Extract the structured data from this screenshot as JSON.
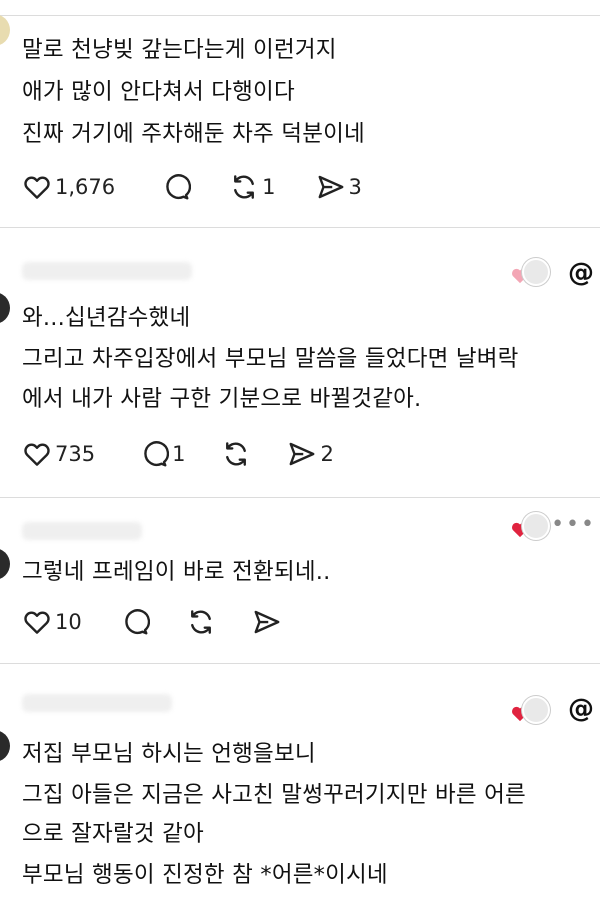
{
  "posts": [
    {
      "lines": [
        "말로 천냥빚 갚는다는게 이런거지",
        "애가 많이 안다쳐서 다행이다",
        "진짜 거기에 주차해둔 차주 덕분이네"
      ],
      "likes": "1,676",
      "replies": "",
      "reposts": "1",
      "shares": "3",
      "icons": {
        "like": "heart-outline-icon",
        "reply": "speech-bubble-icon",
        "repost": "repost-icon",
        "share": "send-icon"
      }
    },
    {
      "lines": [
        "와...십년감수했네",
        "그리고 차주입장에서 부모님 말씀을 들었다면 날벼락",
        "에서 내가 사람 구한 기분으로 바뀔것같아."
      ],
      "likes": "735",
      "replies": "1",
      "reposts": "",
      "shares": "2",
      "liked_by_author_color": "#f3a6b5",
      "right_icon": "threads-logo-icon"
    },
    {
      "lines": [
        "그렇네 프레임이 바로 전환되네.."
      ],
      "likes": "10",
      "replies": "",
      "reposts": "",
      "shares": "",
      "liked_by_author_color": "#e0233f",
      "right_icon": "more-options-icon"
    },
    {
      "lines": [
        "저집 부모님 하시는 언행을보니",
        "그집 아들은 지금은 사고친 말썽꾸러기지만 바른 어른",
        "으로 잘자랄것 같아",
        "부모님 행동이 진정한 참 *어른*이시네"
      ],
      "liked_by_author_color": "#e0233f",
      "right_icon": "threads-logo-icon"
    }
  ],
  "symbols": {
    "threads": "@",
    "more": "•••"
  }
}
